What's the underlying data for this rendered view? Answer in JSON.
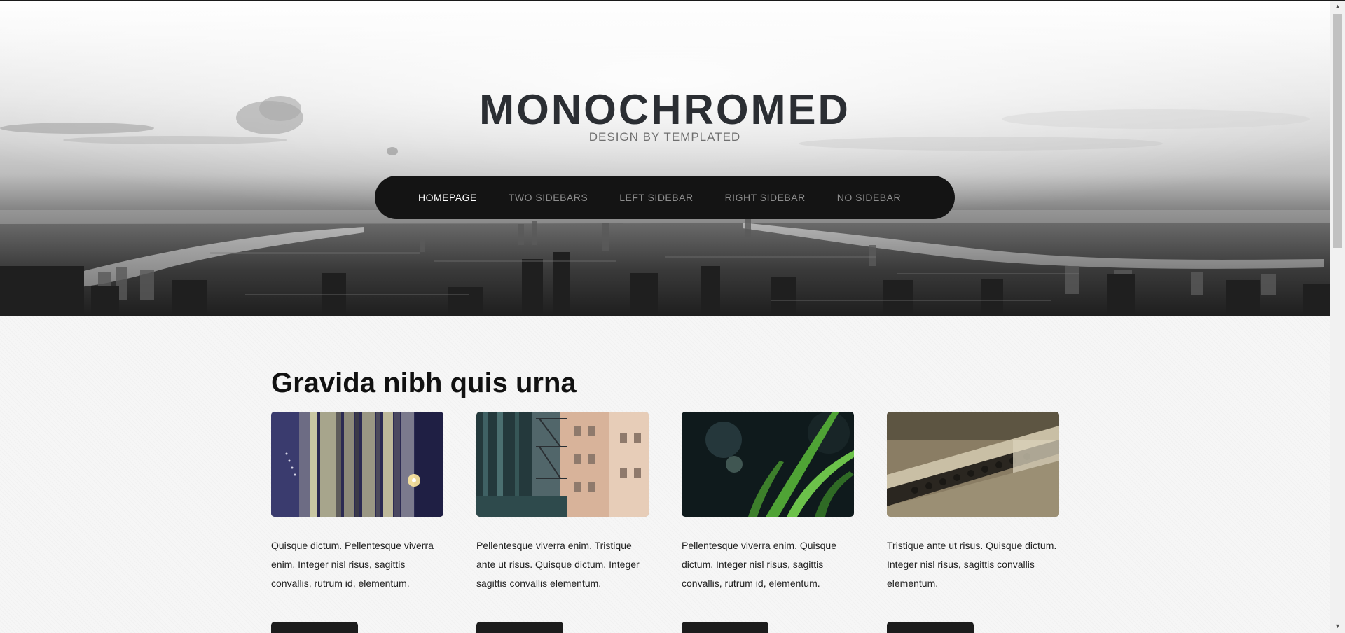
{
  "site": {
    "title": "MONOCHROMED",
    "subtitle": "DESIGN BY TEMPLATED"
  },
  "nav": {
    "items": [
      {
        "label": "HOMEPAGE",
        "active": true
      },
      {
        "label": "TWO SIDEBARS",
        "active": false
      },
      {
        "label": "LEFT SIDEBAR",
        "active": false
      },
      {
        "label": "RIGHT SIDEBAR",
        "active": false
      },
      {
        "label": "NO SIDEBAR",
        "active": false
      }
    ]
  },
  "main": {
    "heading": "Gravida nibh quis urna",
    "cards": [
      {
        "image": "night-building-image",
        "text": "Quisque dictum. Pellentesque viverra enim. Integer nisl risus, sagittis convallis, rutrum id, elementum."
      },
      {
        "image": "fire-escape-building-image",
        "text": "Pellentesque viverra enim. Tristique ante ut risus. Quisque dictum. Integer sagittis convallis elementum."
      },
      {
        "image": "green-grass-image",
        "text": "Pellentesque viverra enim. Quisque dictum. Integer nisl risus, sagittis convallis, rutrum id, elementum."
      },
      {
        "image": "railroad-track-image",
        "text": "Tristique ante ut risus. Quisque dictum. Integer nisl risus, sagittis convallis elementum."
      }
    ]
  },
  "scrollbar": {
    "up_icon": "arrow-up-icon",
    "down_icon": "arrow-down-icon"
  },
  "colors": {
    "nav_background": "#141414",
    "title": "#2b2e33",
    "nav_active": "#ffffff",
    "nav_inactive": "#8d8d8d"
  }
}
